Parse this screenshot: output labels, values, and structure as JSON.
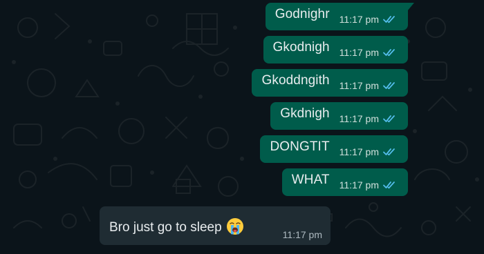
{
  "messages": [
    {
      "direction": "outgoing",
      "text": "Godnighr",
      "time": "11:17 pm",
      "status": "read-ticks-icon"
    },
    {
      "direction": "outgoing",
      "text": "Gkodnigh",
      "time": "11:17 pm",
      "status": "read-ticks-icon"
    },
    {
      "direction": "outgoing",
      "text": "Gkoddngith",
      "time": "11:17 pm",
      "status": "read-ticks-icon"
    },
    {
      "direction": "outgoing",
      "text": "Gkdnigh",
      "time": "11:17 pm",
      "status": "read-ticks-icon"
    },
    {
      "direction": "outgoing",
      "text": "DONGTIT",
      "time": "11:17 pm",
      "status": "read-ticks-icon"
    },
    {
      "direction": "outgoing",
      "text": "WHAT",
      "time": "11:17 pm",
      "status": "read-ticks-icon"
    },
    {
      "direction": "incoming",
      "text": "Bro just go to sleep",
      "emoji": "loudly-crying-face-icon",
      "time": "11:17 pm"
    }
  ],
  "colors": {
    "background": "#0b141a",
    "outgoing_bubble": "#005c4b",
    "incoming_bubble": "#1f2c33",
    "read_ticks": "#53bdeb",
    "text": "#e9edef"
  }
}
